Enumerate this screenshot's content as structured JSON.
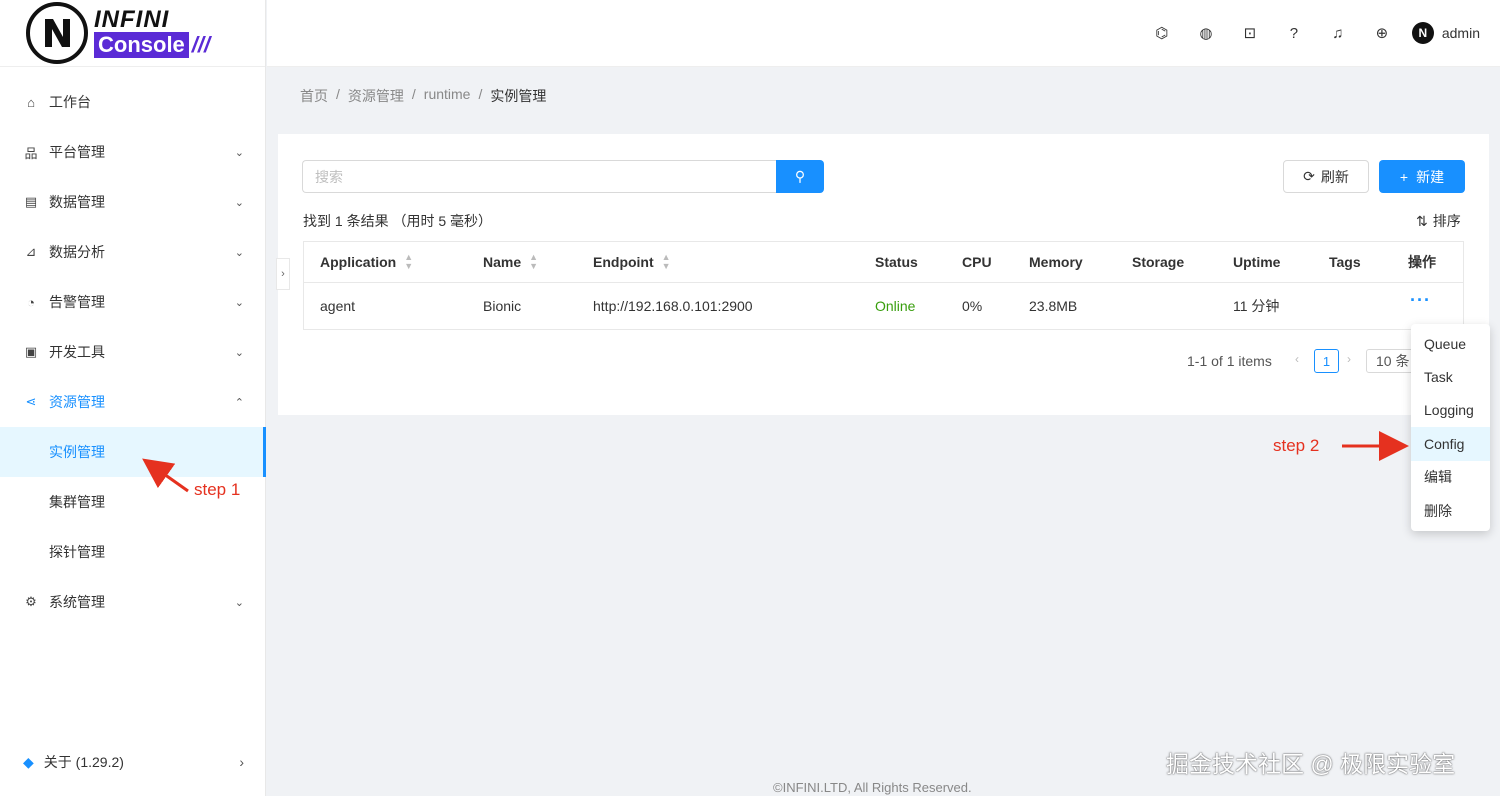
{
  "logo": {
    "line1": "INFINI",
    "line2": "Console",
    "slashes": "///"
  },
  "sidebar": {
    "items": [
      {
        "label": "工作台",
        "icon": "home-icon",
        "glyph": "⌂",
        "chevron": ""
      },
      {
        "label": "平台管理",
        "icon": "cluster-icon",
        "glyph": "品",
        "chevron": "⌄"
      },
      {
        "label": "数据管理",
        "icon": "database-icon",
        "glyph": "▤",
        "chevron": "⌄"
      },
      {
        "label": "数据分析",
        "icon": "chart-icon",
        "glyph": "⊿",
        "chevron": "⌄"
      },
      {
        "label": "告警管理",
        "icon": "alarm-icon",
        "glyph": "◔",
        "chevron": "⌄"
      },
      {
        "label": "开发工具",
        "icon": "terminal-icon",
        "glyph": "▣",
        "chevron": "⌄"
      },
      {
        "label": "资源管理",
        "icon": "share-icon",
        "glyph": "⋖",
        "chevron": "⌃"
      }
    ],
    "sub_items": [
      {
        "label": "实例管理"
      },
      {
        "label": "集群管理"
      },
      {
        "label": "探针管理"
      }
    ],
    "settings": {
      "label": "系统管理",
      "icon": "gear-icon",
      "glyph": "⚙",
      "chevron": "⌄"
    },
    "about": {
      "label": "关于 (1.29.2)",
      "glyph": "◆",
      "chevron": "›"
    }
  },
  "header": {
    "icons": [
      {
        "name": "discord-icon",
        "glyph": "⌬"
      },
      {
        "name": "theme-icon",
        "glyph": "◍"
      },
      {
        "name": "terminal-icon",
        "glyph": "⊡"
      },
      {
        "name": "help-icon",
        "glyph": "?"
      },
      {
        "name": "bell-icon",
        "glyph": "♫"
      },
      {
        "name": "globe-icon",
        "glyph": "⊕"
      }
    ],
    "avatar": "N",
    "username": "admin"
  },
  "breadcrumb": {
    "items": [
      "首页",
      "资源管理",
      "runtime",
      "实例管理"
    ],
    "sep": "/"
  },
  "search": {
    "placeholder": "搜索",
    "icon": "⚲"
  },
  "toolbar": {
    "refresh_label": "刷新",
    "refresh_glyph": "⟳",
    "new_label": "新建",
    "new_glyph": "+"
  },
  "result_text": "找到 1 条结果 （用时 5 毫秒）",
  "sort": {
    "label": "排序",
    "glyph": "⇅"
  },
  "table": {
    "columns": [
      "Application",
      "Name",
      "Endpoint",
      "Status",
      "CPU",
      "Memory",
      "Storage",
      "Uptime",
      "Tags",
      "操作"
    ],
    "sort_glyph_up": "▲",
    "sort_glyph_down": "▼",
    "rows": [
      {
        "application": "agent",
        "name": "Bionic",
        "endpoint": "http://192.168.0.101:2900",
        "status": "Online",
        "cpu": "0%",
        "memory": "23.8MB",
        "storage": "",
        "uptime": "11 分钟",
        "tags": "",
        "action": "···"
      }
    ]
  },
  "pagination": {
    "range": "1-1 of 1 items",
    "prev": "‹",
    "page": "1",
    "next": "›",
    "page_size": "10 条"
  },
  "dropdown": {
    "items": [
      "Queue",
      "Task",
      "Logging",
      "Config",
      "编辑",
      "删除"
    ]
  },
  "annotations": {
    "step1": "step 1",
    "step2": "step 2",
    "arrow_color": "#e5311f"
  },
  "collapse_glyph": "›",
  "watermark": "掘金技术社区 @ 极限实验室",
  "footer": "©INFINI.LTD, All Rights Reserved.",
  "colors": {
    "primary": "#1890ff",
    "online": "#389e0d",
    "brand": "#5b2bd6"
  }
}
